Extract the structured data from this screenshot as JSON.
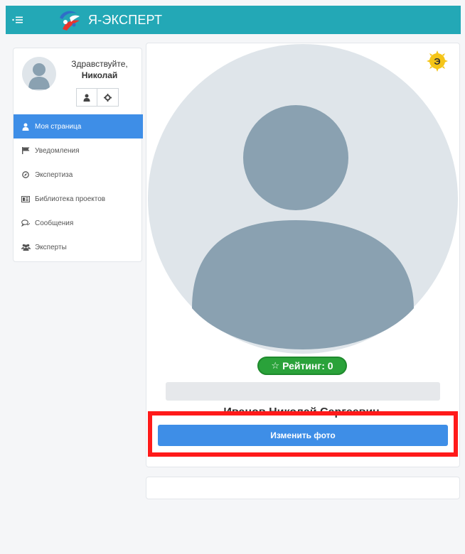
{
  "header": {
    "app_name": "Я-ЭКСПЕРТ",
    "menu_icon": "hamburger-icon",
    "brand_color": "#23a8b6"
  },
  "user_panel": {
    "greeting": "Здравствуйте,",
    "first_name": "Николай",
    "tools": [
      "user-icon",
      "gear-icon"
    ]
  },
  "sidebar": {
    "items": [
      {
        "label": "Моя страница",
        "icon": "user-icon",
        "active": true
      },
      {
        "label": "Уведомления",
        "icon": "flag-icon",
        "active": false
      },
      {
        "label": "Экспертиза",
        "icon": "compass-icon",
        "active": false
      },
      {
        "label": "Библиотека проектов",
        "icon": "library-icon",
        "active": false
      },
      {
        "label": "Сообщения",
        "icon": "chat-icon",
        "active": false
      },
      {
        "label": "Эксперты",
        "icon": "users-icon",
        "active": false
      }
    ],
    "active_color": "#3e8ee7"
  },
  "profile": {
    "badge_letter": "Э",
    "rating_label": "Рейтинг: 0",
    "full_name": "Иванов Николай Сергеевич",
    "change_photo_label": "Изменить фото"
  },
  "colors": {
    "rating_green": "#2aa23a",
    "highlight_red": "#ff1a1a",
    "button_blue": "#3e8ee7"
  }
}
